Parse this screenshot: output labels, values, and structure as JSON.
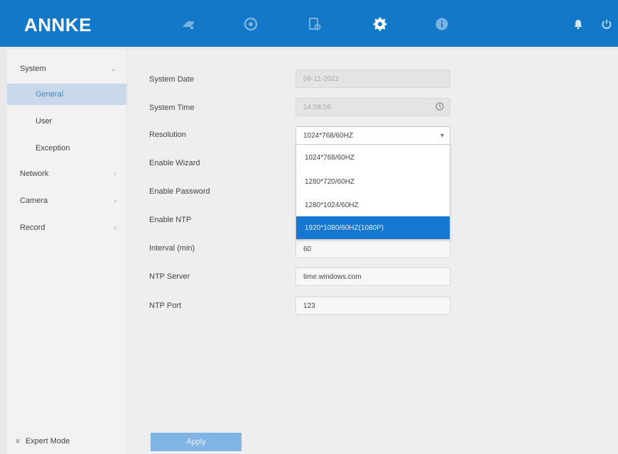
{
  "header": {
    "logo": "ANNKE",
    "nav": [
      {
        "name": "live-view-icon"
      },
      {
        "name": "playback-icon"
      },
      {
        "name": "file-management-icon"
      },
      {
        "name": "configuration-icon"
      },
      {
        "name": "info-icon"
      }
    ],
    "colors": {
      "bar": "#1478c8"
    }
  },
  "sidebar": {
    "items": [
      {
        "label": "System"
      },
      {
        "label": "General"
      },
      {
        "label": "User"
      },
      {
        "label": "Exception"
      },
      {
        "label": "Network"
      },
      {
        "label": "Camera"
      },
      {
        "label": "Record"
      }
    ],
    "expert_mode": "Expert Mode"
  },
  "form": {
    "system_date": {
      "label": "System Date",
      "value": "09-11-2021"
    },
    "system_time": {
      "label": "System Time",
      "value": "14:58:56"
    },
    "resolution": {
      "label": "Resolution",
      "value": "1024*768/60HZ",
      "options": [
        "1024*768/60HZ",
        "1280*720/60HZ",
        "1280*1024/60HZ",
        "1920*1080/60HZ(1080P)"
      ],
      "highlighted": "1920*1080/60HZ(1080P)"
    },
    "enable_wizard": {
      "label": "Enable Wizard"
    },
    "enable_password": {
      "label": "Enable Password"
    },
    "enable_ntp": {
      "label": "Enable NTP"
    },
    "interval": {
      "label": "Interval (min)",
      "value": "60"
    },
    "ntp_server": {
      "label": "NTP Server",
      "value": "time.windows.com"
    },
    "ntp_port": {
      "label": "NTP Port",
      "value": "123"
    },
    "apply_label": "Apply"
  }
}
